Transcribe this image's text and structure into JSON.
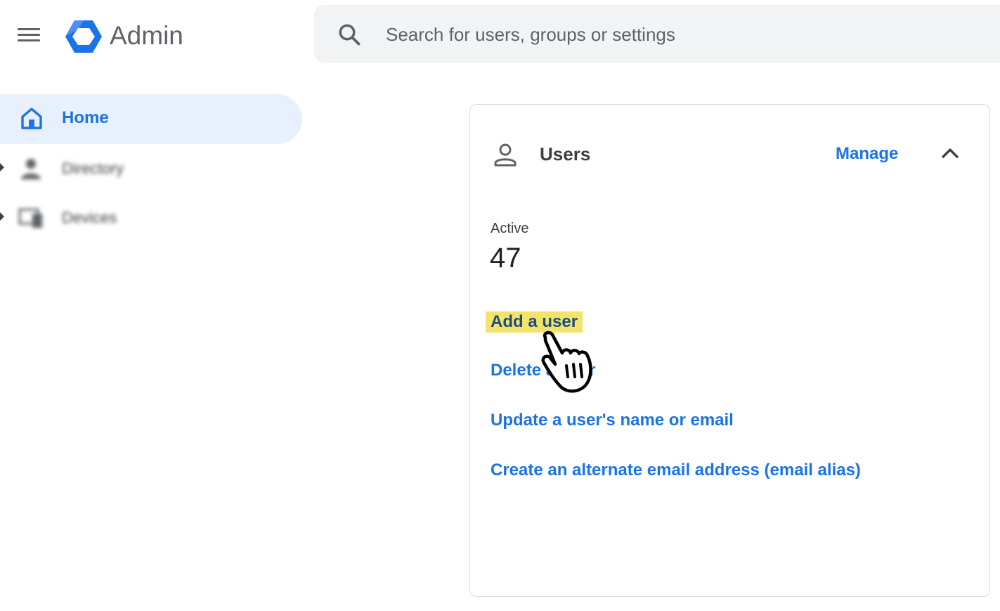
{
  "app": {
    "title": "Admin"
  },
  "search": {
    "placeholder": "Search for users, groups or settings"
  },
  "sidebar": {
    "items": [
      {
        "label": "Home",
        "icon": "home-icon",
        "active": true
      },
      {
        "label": "Directory",
        "icon": "person-icon",
        "active": false
      },
      {
        "label": "Devices",
        "icon": "devices-icon",
        "active": false
      }
    ]
  },
  "users_card": {
    "title": "Users",
    "manage_label": "Manage",
    "stat_label": "Active",
    "stat_value": "47",
    "links": [
      "Add a user",
      "Delete a user",
      "Update a user's name or email",
      "Create an alternate email address (email alias)"
    ]
  },
  "colors": {
    "accent": "#1a73e8",
    "active_nav_bg": "#e8f0fe",
    "highlight": "#f4e36a",
    "search_bg": "#f1f3f4"
  }
}
